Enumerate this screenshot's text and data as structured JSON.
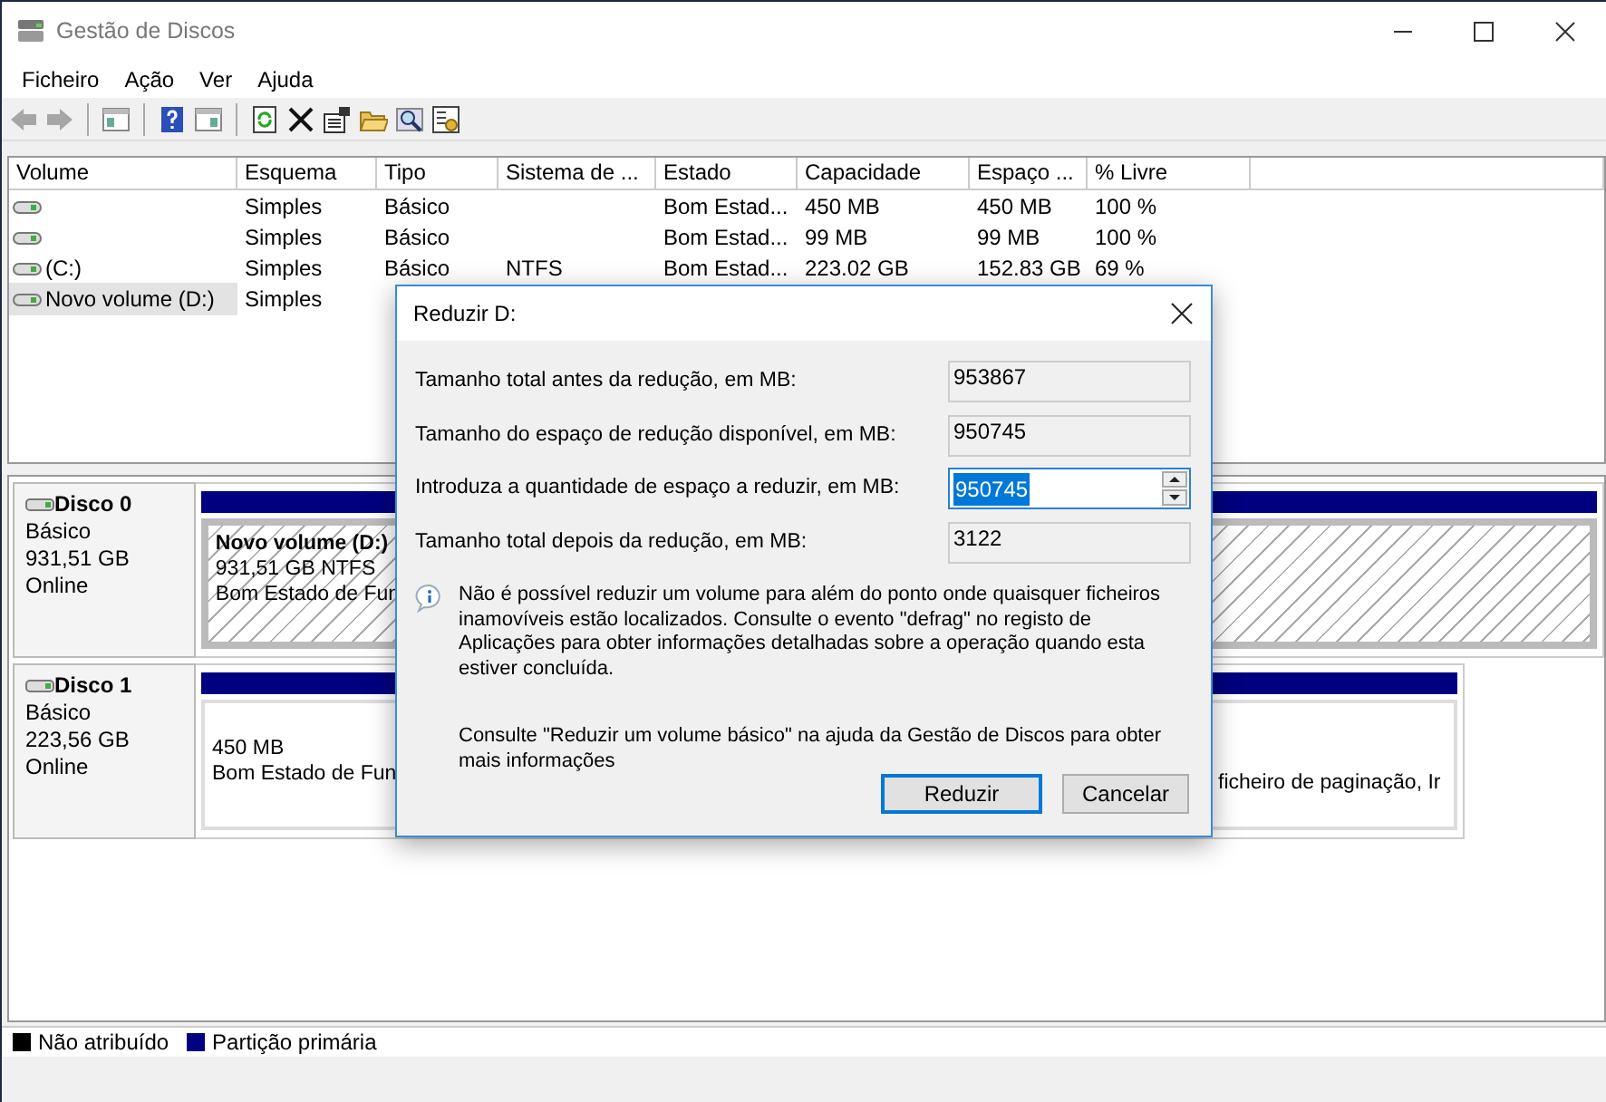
{
  "window": {
    "title": "Gestão de Discos"
  },
  "menu": [
    "Ficheiro",
    "Ação",
    "Ver",
    "Ajuda"
  ],
  "toolbar": [
    {
      "kind": "back",
      "disabled": true
    },
    {
      "kind": "forward",
      "disabled": true
    },
    {
      "kind": "separator"
    },
    {
      "kind": "tree",
      "disabled": false
    },
    {
      "kind": "separator"
    },
    {
      "kind": "help",
      "disabled": false
    },
    {
      "kind": "panel",
      "disabled": false
    },
    {
      "kind": "separator"
    },
    {
      "kind": "refresh",
      "disabled": false
    },
    {
      "kind": "delete",
      "disabled": false
    },
    {
      "kind": "properties",
      "disabled": false
    },
    {
      "kind": "folder",
      "disabled": false
    },
    {
      "kind": "search",
      "disabled": false
    },
    {
      "kind": "settings",
      "disabled": false
    }
  ],
  "volume_table": {
    "columns": [
      "Volume",
      "Esquema",
      "Tipo",
      "Sistema de ...",
      "Estado",
      "Capacidade",
      "Espaço ...",
      "% Livre"
    ],
    "rows": [
      {
        "selected": false,
        "cells": [
          "",
          "Simples",
          "Básico",
          "",
          "Bom Estad...",
          "450 MB",
          "450 MB",
          "100 %"
        ]
      },
      {
        "selected": false,
        "cells": [
          "",
          "Simples",
          "Básico",
          "",
          "Bom Estad...",
          "99 MB",
          "99 MB",
          "100 %"
        ]
      },
      {
        "selected": false,
        "cells": [
          "(C:)",
          "Simples",
          "Básico",
          "NTFS",
          "Bom Estad...",
          "223.02 GB",
          "152.83 GB",
          "69 %"
        ]
      },
      {
        "selected": true,
        "cells": [
          "Novo volume (D:)",
          "Simples",
          "",
          "",
          "",
          "",
          "",
          ""
        ]
      }
    ]
  },
  "disks": [
    {
      "name": "Disco 0",
      "type": "Básico",
      "size": "931,51 GB",
      "status": "Online",
      "partitions": [
        {
          "label": "Novo volume  (D:)",
          "lines": [
            "931,51 GB NTFS",
            "Bom Estado de Fun"
          ],
          "selected": true
        }
      ]
    },
    {
      "name": "Disco 1",
      "type": "Básico",
      "size": "223,56 GB",
      "status": "Online",
      "partitions": [
        {
          "lines": [
            "450 MB",
            "Bom Estado de Fun"
          ],
          "selected": false
        },
        {
          "lines": [
            "ficheiro de paginação, Ir"
          ],
          "selected": false
        }
      ]
    }
  ],
  "legend": [
    {
      "label": "Não atribuído",
      "color": "#000000"
    },
    {
      "label": "Partição primária",
      "color": "#000080"
    }
  ],
  "dialog": {
    "title": "Reduzir D:",
    "fields": [
      {
        "kind": "readonly",
        "label": "Tamanho total antes da redução, em MB:",
        "value": "953867"
      },
      {
        "kind": "readonly",
        "label": "Tamanho do espaço de redução disponível, em MB:",
        "value": "950745"
      },
      {
        "kind": "spin",
        "label": "Introduza a quantidade de espaço a reduzir, em MB:",
        "value": "950745"
      },
      {
        "kind": "readonly",
        "label": "Tamanho total depois da redução, em MB:",
        "value": "3122"
      }
    ],
    "info": "Não é possível reduzir um volume para além do ponto onde quaisquer ficheiros inamovíveis estão localizados. Consulte o evento \"defrag\" no registo de Aplicações para obter informações detalhadas sobre a operação quando esta estiver concluída.",
    "help": "Consulte \"Reduzir um volume básico\" na ajuda da Gestão de Discos para obter mais informações",
    "buttons": [
      {
        "label": "Reduzir",
        "default": true
      },
      {
        "label": "Cancelar",
        "default": false
      }
    ]
  }
}
